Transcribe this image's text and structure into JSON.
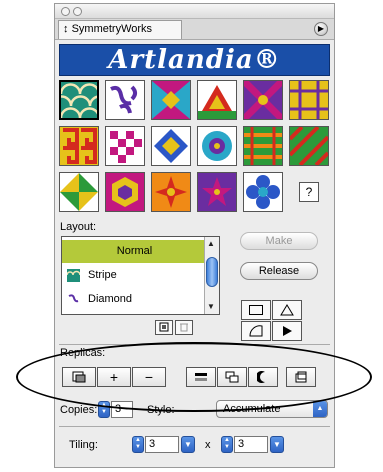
{
  "window": {
    "tab_title": "SymmetryWorks",
    "tab_arrow": "↕",
    "menu_glyph": "▶"
  },
  "banner": {
    "brand": "Artlandia®"
  },
  "patterns": {
    "help_glyph": "?",
    "colors": {
      "teal": "#1f8f7a",
      "purple": "#6a2da0",
      "magenta": "#c2187f",
      "red": "#d42a1e",
      "green": "#2c9a3a",
      "yellow": "#e6c21a",
      "orange": "#f08a16",
      "blue": "#2b57c7",
      "cyan": "#2aa7c8"
    }
  },
  "layout": {
    "label": "Layout:",
    "items": [
      {
        "label": "Normal",
        "selected": true
      },
      {
        "label": "Stripe",
        "selected": false
      },
      {
        "label": "Diamond",
        "selected": false
      }
    ],
    "make_label": "Make",
    "release_label": "Release"
  },
  "replicas": {
    "label": "Replicas:",
    "plus_label": "+",
    "minus_label": "−"
  },
  "copies": {
    "label": "Copies:",
    "value": "3"
  },
  "style": {
    "label": "Style:",
    "value": "Accumulate"
  },
  "tiling": {
    "label": "Tiling:",
    "x_value": "3",
    "separator": "x",
    "y_value": "3"
  }
}
